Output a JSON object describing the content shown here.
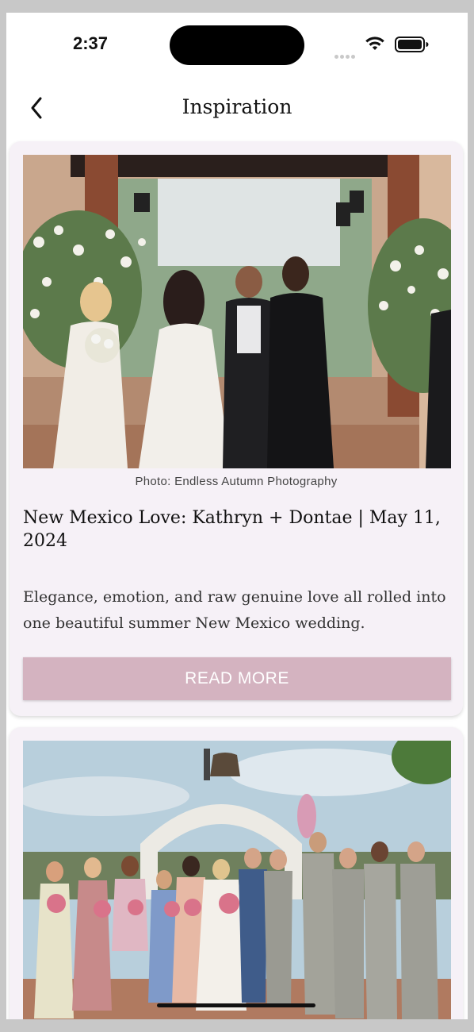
{
  "status_bar": {
    "time": "2:37"
  },
  "nav": {
    "title": "Inspiration"
  },
  "icons": {
    "back": "chevron-left-icon",
    "wifi": "wifi-icon",
    "battery": "battery-icon",
    "signal": "cellular-signal-icon"
  },
  "colors": {
    "card_bg": "#f6f1f7",
    "button_bg": "#d4b3c0",
    "button_text": "#ffffff"
  },
  "posts": [
    {
      "photo_credit": "Photo: Endless Autumn Photography",
      "title": "New Mexico Love: Kathryn + Dontae | May 11, 2024",
      "description": "Elegance, emotion, and raw genuine love all rolled into one beautiful summer New Mexico wedding.",
      "button_label": "READ MORE"
    },
    {
      "photo_credit": "",
      "title": "",
      "description": "",
      "button_label": ""
    }
  ]
}
